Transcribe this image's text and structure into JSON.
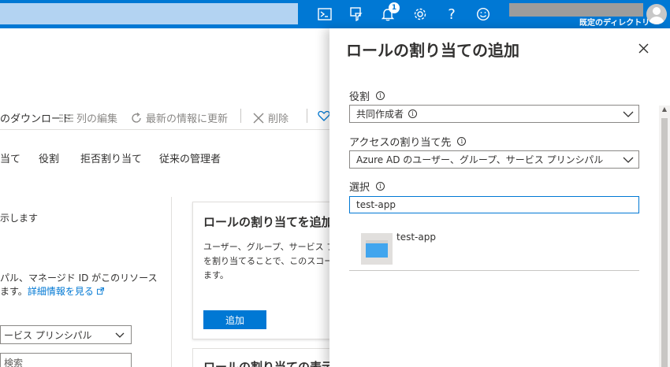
{
  "topbar": {
    "notification_count": "1",
    "directory_label": "既定のディレクトリ",
    "icons": [
      "cloud-shell-icon",
      "directory-filter-icon",
      "bell-icon",
      "gear-icon",
      "help-icon",
      "feedback-smiley-icon"
    ]
  },
  "background": {
    "commands": {
      "download": "のダウンロード",
      "edit_columns": "列の編集",
      "refresh": "最新の情報に更新",
      "delete": "削除"
    },
    "tabs": [
      "当て",
      "役割",
      "拒否割り当て",
      "従来の管理者"
    ],
    "left_texts": {
      "line1": "示します",
      "line2": "パル、マネージド ID がこのリソース",
      "line3_prefix": "ます。",
      "learn_more": "詳細情報を見る"
    },
    "select_value": "ービス プリンシパル",
    "search_placeholder": "検索",
    "card": {
      "title": "ロールの割り当てを追加す",
      "text1": "ユーザー、グループ、サービス プリン",
      "text2": "を割り当てることで、このスコープの",
      "text3": "ます。",
      "add_button": "追加"
    },
    "card2_title": "ロールの割り当ての表示"
  },
  "blade": {
    "title": "ロールの割り当ての追加",
    "role": {
      "label": "役割",
      "value": "共同作成者"
    },
    "assign_access": {
      "label": "アクセスの割り当て先",
      "value": "Azure AD のユーザー、グループ、サービス プリンシパル"
    },
    "select": {
      "label": "選択",
      "value": "test-app"
    },
    "results": [
      {
        "name": "test-app"
      }
    ]
  }
}
